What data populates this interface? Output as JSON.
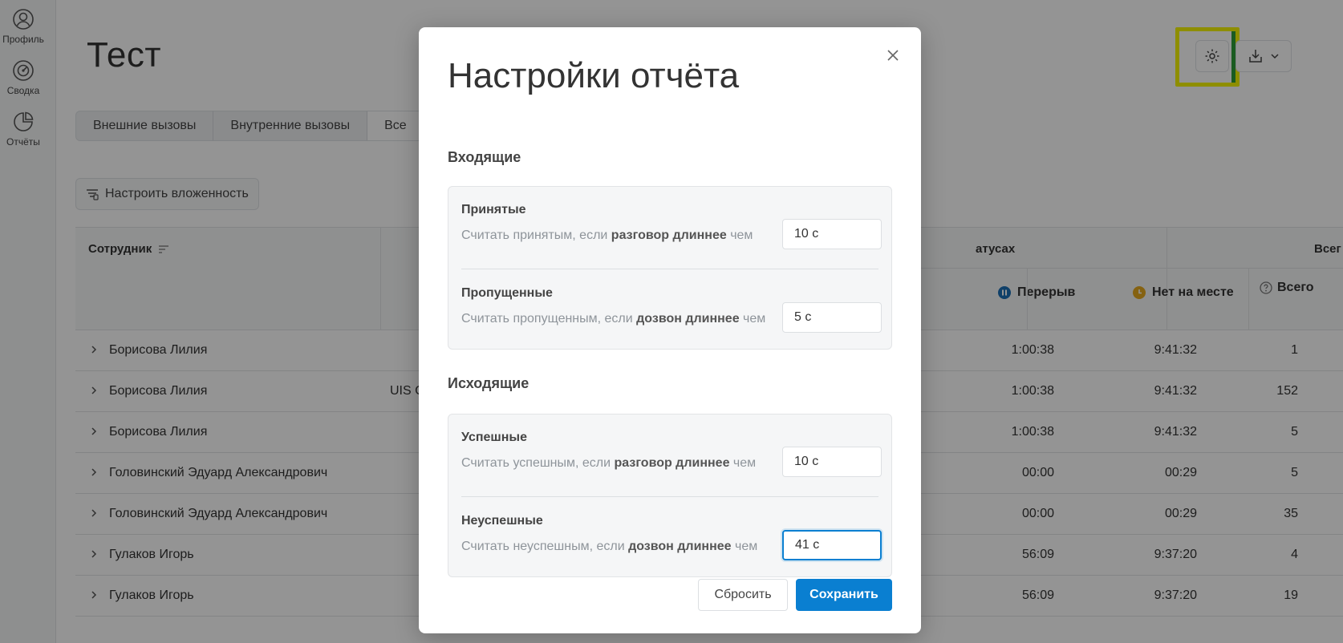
{
  "sidebar": {
    "items": [
      {
        "label": "Профиль",
        "icon": "user-icon"
      },
      {
        "label": "Сводка",
        "icon": "dashboard-icon"
      },
      {
        "label": "Отчёты",
        "icon": "pie-chart-icon"
      }
    ]
  },
  "main": {
    "title": "Тест",
    "tabs": [
      {
        "label": "Внешние вызовы"
      },
      {
        "label": "Внутренние вызовы"
      },
      {
        "label": "Все"
      }
    ],
    "nesting_button": "Настроить вложенность",
    "toolbar": {
      "settings_icon": "gear-icon",
      "download_icon": "download-icon"
    },
    "table": {
      "header": {
        "employee": "Сотрудник",
        "statuses_partial": "атусах",
        "total_partial": "Всег",
        "break": "Перерыв",
        "away": "Нет на месте",
        "total": "Всего"
      },
      "status_colors": {
        "break": "#1a6fb5",
        "away": "#e6a91e"
      },
      "rows": [
        {
          "name": "Борисова Лилия",
          "org": "",
          "break": "1:00:38",
          "away": "9:41:32",
          "total": "1"
        },
        {
          "name": "Борисова Лилия",
          "org": "UIS C",
          "break": "1:00:38",
          "away": "9:41:32",
          "total": "152"
        },
        {
          "name": "Борисова Лилия",
          "org": "",
          "break": "1:00:38",
          "away": "9:41:32",
          "total": "5"
        },
        {
          "name": "Головинский Эдуард Александрович",
          "org": "",
          "break": "00:00",
          "away": "00:29",
          "total": "5"
        },
        {
          "name": "Головинский Эдуард Александрович",
          "org": "",
          "break": "00:00",
          "away": "00:29",
          "total": "35"
        },
        {
          "name": "Гулаков Игорь",
          "org": "",
          "break": "56:09",
          "away": "9:37:20",
          "total": "4"
        },
        {
          "name": "Гулаков Игорь",
          "org": "",
          "break": "56:09",
          "away": "9:37:20",
          "total": "19"
        }
      ]
    }
  },
  "modal": {
    "title": "Настройки отчёта",
    "incoming": {
      "title": "Входящие",
      "accepted": {
        "title": "Принятые",
        "desc_pre": "Считать принятым, если ",
        "desc_bold": "разговор длиннее",
        "desc_post": " чем",
        "value": "10 с"
      },
      "missed": {
        "title": "Пропущенные",
        "desc_pre": "Считать пропущенным, если ",
        "desc_bold": "дозвон длиннее",
        "desc_post": " чем",
        "value": "5 с"
      }
    },
    "outgoing": {
      "title": "Исходящие",
      "successful": {
        "title": "Успешные",
        "desc_pre": "Считать успешным, если ",
        "desc_bold": "разговор длиннее",
        "desc_post": " чем",
        "value": "10 с"
      },
      "unsuccessful": {
        "title": "Неуспешные",
        "desc_pre": "Считать неуспешным, если ",
        "desc_bold": "дозвон длиннее",
        "desc_post": " чем",
        "value": "41 с"
      }
    },
    "reset_label": "Сбросить",
    "save_label": "Сохранить"
  }
}
